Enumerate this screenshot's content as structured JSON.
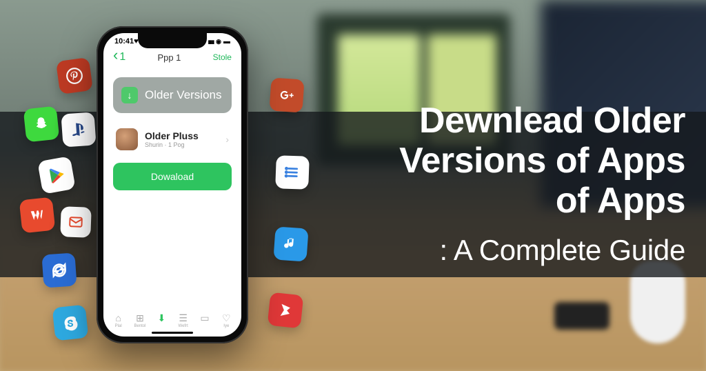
{
  "headline": {
    "line1": "Dewnlead Older",
    "line2": "Versions of Apps",
    "line3": "of Apps",
    "subtitle": ": A Complete Guide"
  },
  "phone": {
    "status_time": "10:41♥",
    "header": {
      "back_number": "1",
      "title": "Ppp 1",
      "action": "Stole"
    },
    "older_card": {
      "label": "Older Versions"
    },
    "list_item": {
      "title": "Older Pluss",
      "subtitle": "Shurin · 1 Pog"
    },
    "download_button": "Dowaload",
    "tabs": [
      {
        "icon": "home",
        "label": "Plal"
      },
      {
        "icon": "grid",
        "label": "Bentol"
      },
      {
        "icon": "arrow",
        "label": ""
      },
      {
        "icon": "stack",
        "label": "Wefrt"
      },
      {
        "icon": "book",
        "label": ""
      },
      {
        "icon": "heart",
        "label": "Iye"
      }
    ]
  },
  "icons": {
    "pinterest": "pinterest",
    "snapchat": "snapchat",
    "playstation": "playstation",
    "playstore": "playstore",
    "wattpad": "wattpad",
    "mail": "mail",
    "sync": "sync",
    "skype": "skype",
    "gplus": "gplus",
    "list": "list",
    "music": "music",
    "red": "red-app"
  }
}
